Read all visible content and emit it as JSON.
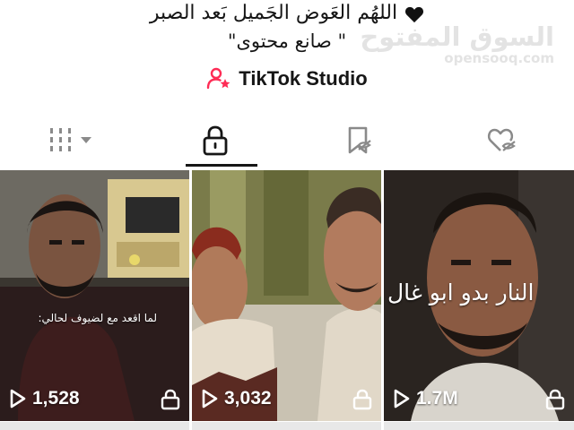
{
  "profile": {
    "bio_line1": "اللهُم العَوض الجَميل بَعد الصبر",
    "bio_line2": "\"صانع محتوى \"",
    "studio_label": "TikTok Studio"
  },
  "watermark": {
    "arabic": "السوق المفتوح",
    "latin": "opensooq.com"
  },
  "tabs": [
    {
      "icon": "grid-icon",
      "selected": false
    },
    {
      "icon": "lock-icon",
      "selected": true
    },
    {
      "icon": "bookmark-hidden-icon",
      "selected": false
    },
    {
      "icon": "heart-hidden-icon",
      "selected": false
    }
  ],
  "videos": [
    {
      "views": "1,528",
      "caption": "لما اقعد مع لضيوف لحالي:",
      "locked": true
    },
    {
      "views": "3,032",
      "caption": "",
      "locked": true
    },
    {
      "views": "1.7M",
      "caption": "النار بدو ابو غال",
      "locked": true
    }
  ],
  "colors": {
    "accent": "#fe2c55",
    "text": "#161616",
    "icon_gray": "#8a8a8a"
  }
}
